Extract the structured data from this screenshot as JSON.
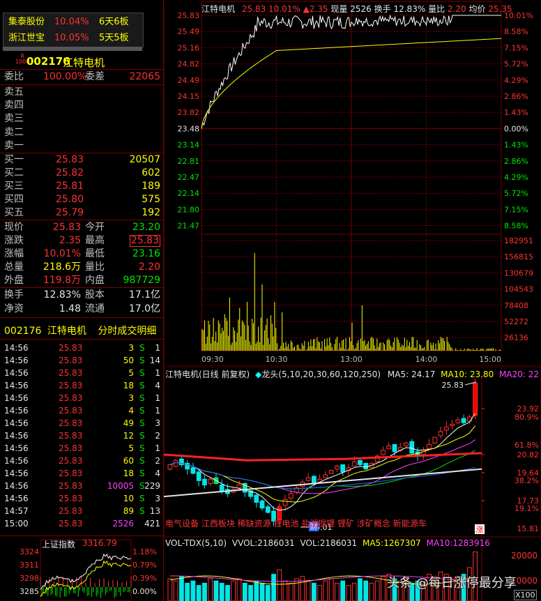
{
  "hot_stocks": [
    {
      "name": "集泰股份",
      "pct": "10.04%",
      "boards": "6天6板"
    },
    {
      "name": "浙江世宝",
      "pct": "10.05%",
      "boards": "5天5板"
    }
  ],
  "stock": {
    "code": "002176",
    "name": "江特电机",
    "badge_top": "R",
    "badge_bottom": "1000"
  },
  "order_ratio": {
    "label1": "委比",
    "value1": "100.00%",
    "label2": "委差",
    "value2": "22065"
  },
  "sell_labels": [
    "卖五",
    "卖四",
    "卖三",
    "卖二",
    "卖一"
  ],
  "buy_orders": [
    {
      "label": "买一",
      "price": "25.83",
      "vol": "20507"
    },
    {
      "label": "买二",
      "price": "25.82",
      "vol": "602"
    },
    {
      "label": "买三",
      "price": "25.81",
      "vol": "189"
    },
    {
      "label": "买四",
      "price": "25.80",
      "vol": "575"
    },
    {
      "label": "买五",
      "price": "25.79",
      "vol": "192"
    }
  ],
  "quote": [
    {
      "l1": "现价",
      "v1": "25.83",
      "l2": "今开",
      "v2": "23.20"
    },
    {
      "l1": "涨跌",
      "v1": "2.35",
      "l2": "最高",
      "v2": "25.83"
    },
    {
      "l1": "涨幅",
      "v1": "10.01%",
      "l2": "最低",
      "v2": "23.16"
    },
    {
      "l1": "总量",
      "v1": "218.6万",
      "l2": "量比",
      "v2": "2.20"
    },
    {
      "l1": "外盘",
      "v1": "119.8万",
      "l2": "内盘",
      "v2": "987729"
    }
  ],
  "shares": [
    {
      "l1": "换手",
      "v1": "12.83%",
      "l2": "股本",
      "v2": "17.1亿"
    },
    {
      "l1": "净资",
      "v1": "1.48",
      "l2": "流通",
      "v2": "17.0亿"
    }
  ],
  "ticks_title": {
    "code": "002176",
    "name": "江特电机",
    "label": "分时成交明细"
  },
  "ticks": [
    {
      "t": "14:56",
      "p": "25.83",
      "v": "3",
      "s": "S",
      "n": "1"
    },
    {
      "t": "14:56",
      "p": "25.83",
      "v": "50",
      "s": "S",
      "n": "14"
    },
    {
      "t": "14:56",
      "p": "25.83",
      "v": "5",
      "s": "S",
      "n": "1"
    },
    {
      "t": "14:56",
      "p": "25.83",
      "v": "18",
      "s": "S",
      "n": "4"
    },
    {
      "t": "14:56",
      "p": "25.83",
      "v": "3",
      "s": "S",
      "n": "1"
    },
    {
      "t": "14:56",
      "p": "25.83",
      "v": "4",
      "s": "S",
      "n": "1"
    },
    {
      "t": "14:56",
      "p": "25.83",
      "v": "49",
      "s": "S",
      "n": "3"
    },
    {
      "t": "14:56",
      "p": "25.83",
      "v": "12",
      "s": "S",
      "n": "2"
    },
    {
      "t": "14:56",
      "p": "25.83",
      "v": "5",
      "s": "S",
      "n": "1"
    },
    {
      "t": "14:56",
      "p": "25.83",
      "v": "60",
      "s": "S",
      "n": "2"
    },
    {
      "t": "14:56",
      "p": "25.83",
      "v": "18",
      "s": "S",
      "n": "4"
    },
    {
      "t": "14:56",
      "p": "25.83",
      "v": "10005",
      "s": "S",
      "n": "229"
    },
    {
      "t": "14:56",
      "p": "25.83",
      "v": "10",
      "s": "S",
      "n": "3"
    },
    {
      "t": "14:57",
      "p": "25.83",
      "v": "89",
      "s": "S",
      "n": "13"
    },
    {
      "t": "15:00",
      "p": "25.83",
      "v": "2526",
      "s": "",
      "n": "421"
    }
  ],
  "index": {
    "name": "上证指数",
    "value": "3316.79",
    "left_ticks": [
      "3324",
      "3311",
      "3298",
      "3285"
    ],
    "right_ticks": [
      "1.18%",
      "0.79%",
      "0.39%",
      "0.00%"
    ]
  },
  "intraday": {
    "header": {
      "name": "江特电机",
      "price": "25.83",
      "pct": "10.01%",
      "change": "▲2.35",
      "vol_label": "现量",
      "vol": "2526",
      "turn_label": "换手",
      "turn": "12.83%",
      "ratio_label": "量比",
      "ratio": "2.20",
      "avg_label": "均价",
      "avg": "25.35"
    },
    "price_ticks": [
      "25.83",
      "25.49",
      "25.16",
      "24.82",
      "24.49",
      "24.15",
      "23.82",
      "23.48",
      "23.14",
      "22.81",
      "22.47",
      "22.14",
      "21.80",
      "21.47"
    ],
    "pct_ticks": [
      "10.01%",
      "8.58%",
      "7.15%",
      "5.72%",
      "4.29%",
      "2.86%",
      "1.43%",
      "0.00%",
      "1.43%",
      "2.86%",
      "4.29%",
      "5.72%",
      "7.15%",
      "8.58%"
    ],
    "vol_ticks": [
      "182951",
      "156815",
      "130679",
      "104543",
      "78408",
      "52272",
      "26136"
    ],
    "time_ticks": [
      "09:30",
      "10:30",
      "13:00",
      "14:00",
      "15:00"
    ]
  },
  "kline": {
    "header": {
      "name": "江特电机(日线 前复权)",
      "tag": "龙头",
      "params": "(5,10,20,30,60,120,250)",
      "ma5_label": "MA5:",
      "ma5": "24.17",
      "ma10_label": "MA10:",
      "ma10": "23.80",
      "ma20_label": "MA20:",
      "ma20": "22"
    },
    "high_label": "25.83",
    "low_label": "16.01",
    "price_ticks": [
      "23.92",
      "20.82",
      "19.64",
      "17.73",
      "15.81"
    ],
    "fib_ticks": [
      "80.9%",
      "61.8%",
      "38.2%",
      "19.1%"
    ],
    "concepts": "电气设备 江西板块 稀缺资源 锂电池 盐湖提锂 锂矿 涉矿概念 新能源车",
    "badge_cai": "财",
    "badge_zhang": "涨"
  },
  "volume": {
    "header": {
      "name": "VOL-TDX(5,10)",
      "vvol_label": "VVOL:",
      "vvol": "2186031",
      "vol_label": "VOL:",
      "vol": "2186031",
      "ma5_label": "MA5:",
      "ma5": "1267307",
      "ma10_label": "MA10:",
      "ma10": "1283916"
    },
    "ticks": [
      "20000",
      "10000"
    ],
    "unit": "X100"
  },
  "watermark": "头条 @每日涨停最分享",
  "colors": {
    "up": "#ff3232",
    "down": "#00e600",
    "flat": "#e6e6e6",
    "accent": "#ffff00",
    "grid": "#7a0000"
  }
}
